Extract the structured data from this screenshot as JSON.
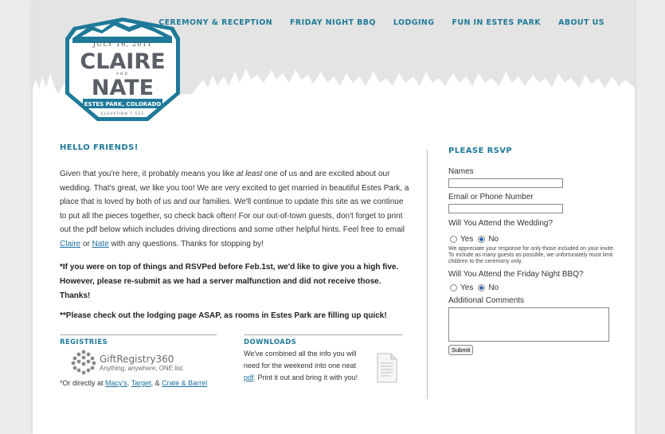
{
  "nav": {
    "items": [
      {
        "label": "CEREMONY & RECEPTION"
      },
      {
        "label": "FRIDAY NIGHT BBQ"
      },
      {
        "label": "LODGING"
      },
      {
        "label": "FUN IN ESTES PARK"
      },
      {
        "label": "ABOUT US"
      }
    ]
  },
  "logo": {
    "date": "JULY 16, 2011",
    "name1": "CLAIRE",
    "and": "AND",
    "name2": "NATE",
    "place": "ESTES PARK, COLORADO",
    "elevation": "ELEVATION 7,522"
  },
  "main": {
    "heading": "HELLO FRIENDS!",
    "intro_part1": "Given that you're here, it probably means you like ",
    "intro_emph": "at least",
    "intro_part2": " one of us and are excited about our wedding. That's great, we like you too! We are very excited to get married in beautiful Estes Park, a place that is loved by both of us and our families. We'll continue to update this site as we continue to put all the pieces together, so check back often! For our out-of-town guests, don't forget to print out the pdf below which includes driving directions and some other helpful hints. Feel free to email ",
    "link_claire": "Claire",
    "intro_or": " or ",
    "link_nate": "Nate",
    "intro_part3": " with any questions. Thanks for stopping by!",
    "note1": "*If you were on top of things and RSVPed before Feb.1st, we'd like to give you a high five. However, please re-submit as we had a server malfunction and did not receive those. Thanks!",
    "note2": "**Please check out the lodging page ASAP, as rooms in Estes Park are filling up quick!"
  },
  "registries": {
    "heading": "REGISTRIES",
    "brand": "GiftRegistry360",
    "tagline": "Anything, anywhere, ONE list.",
    "direct_prefix": "*Or directly at ",
    "link_macys": "Macy's",
    "comma": ", ",
    "link_target": "Target",
    "amp": ", & ",
    "link_crate": "Crate & Barrel"
  },
  "downloads": {
    "heading": "DOWNLOADS",
    "text1": "We've combined all the info you will need for the weekend into one neat ",
    "link_pdf": "pdf",
    "text2": ". Print it out and bring it with you!"
  },
  "rsvp": {
    "heading": "PLEASE RSVP",
    "names_label": "Names",
    "email_label": "Email or Phone Number",
    "wedding_q": "Will You Attend the Wedding?",
    "yes": "Yes",
    "no": "No",
    "wedding_note": "We appreciate your response for only those included on your invite. To include as many guests as possible, we unfortunately must limit children to the ceremony only.",
    "bbq_q": "Will You Attend the Friday Night BBQ?",
    "comments_label": "Additional Comments",
    "submit": "Submit"
  },
  "colors": {
    "accent": "#1f7a99",
    "logo_text": "#5a5e66",
    "header_bg": "#e4e4e4"
  }
}
